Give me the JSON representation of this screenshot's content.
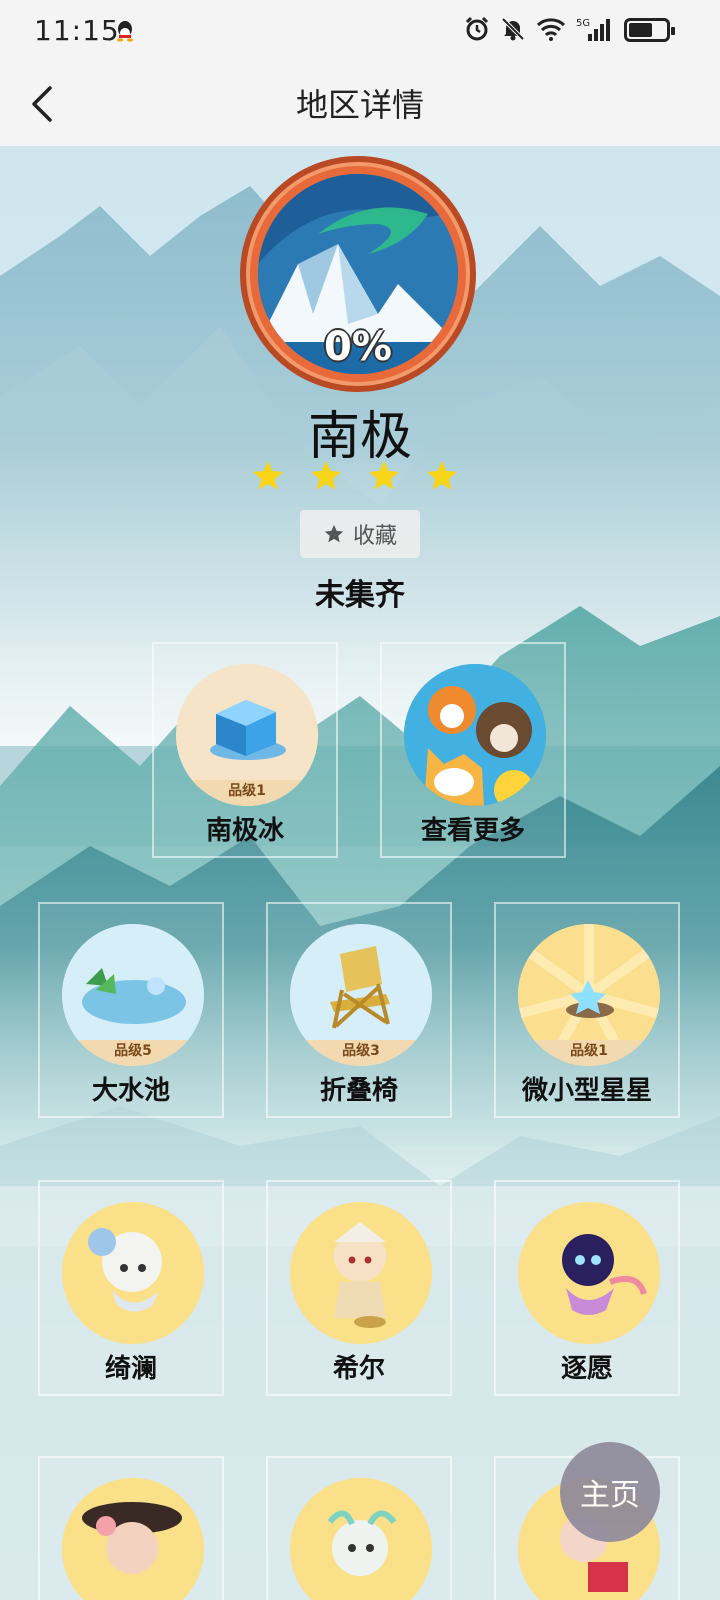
{
  "status_bar": {
    "time": "11:15",
    "network": "5G",
    "battery_level": 0.65
  },
  "header": {
    "title": "地区详情",
    "back_icon": "chevron-left-icon"
  },
  "region": {
    "progress_text": "0%",
    "name": "南极",
    "stars": 4,
    "favorite_label": "收藏",
    "collect_status": "未集齐"
  },
  "featured_items": [
    {
      "label": "南极冰",
      "grade": "品级1"
    },
    {
      "label": "查看更多"
    }
  ],
  "items": [
    {
      "label": "大水池",
      "grade": "品级5"
    },
    {
      "label": "折叠椅",
      "grade": "品级3"
    },
    {
      "label": "微小型星星",
      "grade": "品级1"
    },
    {
      "label": "绮澜"
    },
    {
      "label": "希尔"
    },
    {
      "label": "逐愿"
    },
    {
      "label": ""
    },
    {
      "label": ""
    },
    {
      "label": ""
    }
  ],
  "home_button": {
    "label": "主页"
  },
  "colors": {
    "star": "#f7d417",
    "badge_ring": "#e86a3a",
    "card_bg_yellow": "#fbe08a"
  }
}
